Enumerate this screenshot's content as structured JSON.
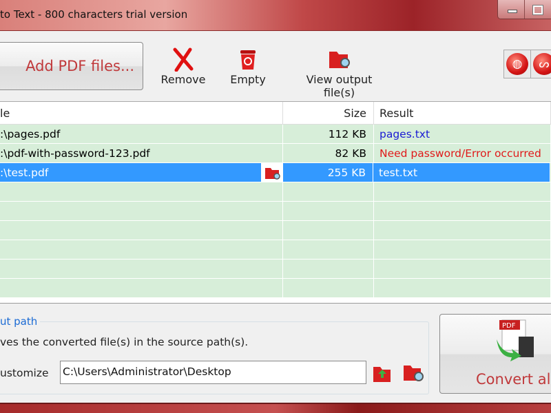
{
  "window": {
    "title": "to Text - 800 characters trial version"
  },
  "toolbar": {
    "add_label": "Add PDF files...",
    "remove_label": "Remove",
    "empty_label": "Empty",
    "view_label": "View output file(s)"
  },
  "table": {
    "headers": [
      "le",
      "Size",
      "Result"
    ],
    "rows": [
      {
        "file": ":\\pages.pdf",
        "size": "112 KB",
        "result": "pages.txt",
        "status": "ok"
      },
      {
        "file": ":\\pdf-with-password-123.pdf",
        "size": "82 KB",
        "result": "Need password/Error occurred",
        "status": "error"
      },
      {
        "file": ":\\test.pdf",
        "size": "255 KB",
        "result": "test.txt",
        "status": "selected"
      }
    ]
  },
  "output": {
    "legend": "ut path",
    "source_option": "ves the converted file(s) in the source path(s).",
    "customize_label": "ustomize",
    "path_value": "C:\\Users\\Administrator\\Desktop"
  },
  "convert": {
    "label": "Convert all"
  },
  "colors": {
    "accent": "#c0393b",
    "row_bg": "#d7eed9",
    "selected": "#3399ff",
    "link": "#1a1ad4",
    "error": "#e01a1a"
  }
}
